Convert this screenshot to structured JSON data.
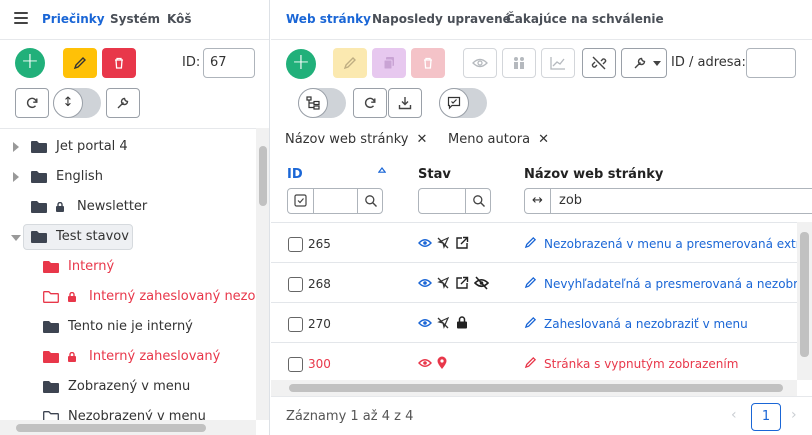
{
  "left": {
    "tabs": [
      "Priečinky",
      "Systém",
      "Kôš"
    ],
    "id_label": "ID:",
    "id_value": "67",
    "tree": [
      {
        "label": "Jet portal 4",
        "style": "normal",
        "lock": false,
        "caret": "right"
      },
      {
        "label": "English",
        "style": "normal",
        "lock": false,
        "caret": "right"
      },
      {
        "label": "Newsletter",
        "style": "normal",
        "lock": true,
        "caret": "none"
      },
      {
        "label": "Test stavov",
        "style": "selected",
        "lock": false,
        "caret": "down"
      },
      {
        "label": "Interný",
        "style": "red",
        "lock": false,
        "caret": "none"
      },
      {
        "label": "Interný zaheslovaný nezobrazený",
        "style": "red-outline",
        "lock": true,
        "caret": "none"
      },
      {
        "label": "Tento nie je interný",
        "style": "normal",
        "lock": false,
        "caret": "none"
      },
      {
        "label": "Interný zaheslovaný",
        "style": "red",
        "lock": true,
        "caret": "none"
      },
      {
        "label": "Zobrazený v menu",
        "style": "normal",
        "lock": false,
        "caret": "none"
      },
      {
        "label": "Nezobrazený v menu",
        "style": "outline",
        "lock": false,
        "caret": "none"
      }
    ]
  },
  "right": {
    "tabs": [
      "Web stránky",
      "Naposledy upravené",
      "Čakajúce na schválenie"
    ],
    "id_address_label": "ID / adresa:",
    "id_address_value": "",
    "chips": [
      "Názov web stránky",
      "Meno autora"
    ],
    "columns": {
      "id": "ID",
      "stav": "Stav",
      "name": "Názov web stránky"
    },
    "filter_name_value": "zob",
    "rows": [
      {
        "id": "265",
        "red": false,
        "name": "Nezobrazená v menu a presmerovaná extrem",
        "icons": [
          "eye",
          "nav-off",
          "external"
        ]
      },
      {
        "id": "268",
        "red": false,
        "name": "Nevyhľadateľná a presmerovaná a nezobrazená",
        "icons": [
          "eye",
          "nav-off",
          "external",
          "eye-off"
        ]
      },
      {
        "id": "270",
        "red": false,
        "name": "Zaheslovaná a nezobraziť v menu",
        "icons": [
          "eye",
          "nav-off",
          "lock"
        ]
      },
      {
        "id": "300",
        "red": true,
        "name": "Stránka s vypnutým zobrazením",
        "icons": [
          "eye",
          "map-pin"
        ]
      }
    ],
    "footer_text": "Záznamy 1 až 4 z 4",
    "current_page": "1"
  },
  "colors": {
    "primary": "#1a66d6",
    "success": "#21b07a",
    "warning": "#ffc107",
    "danger": "#e8374a"
  }
}
